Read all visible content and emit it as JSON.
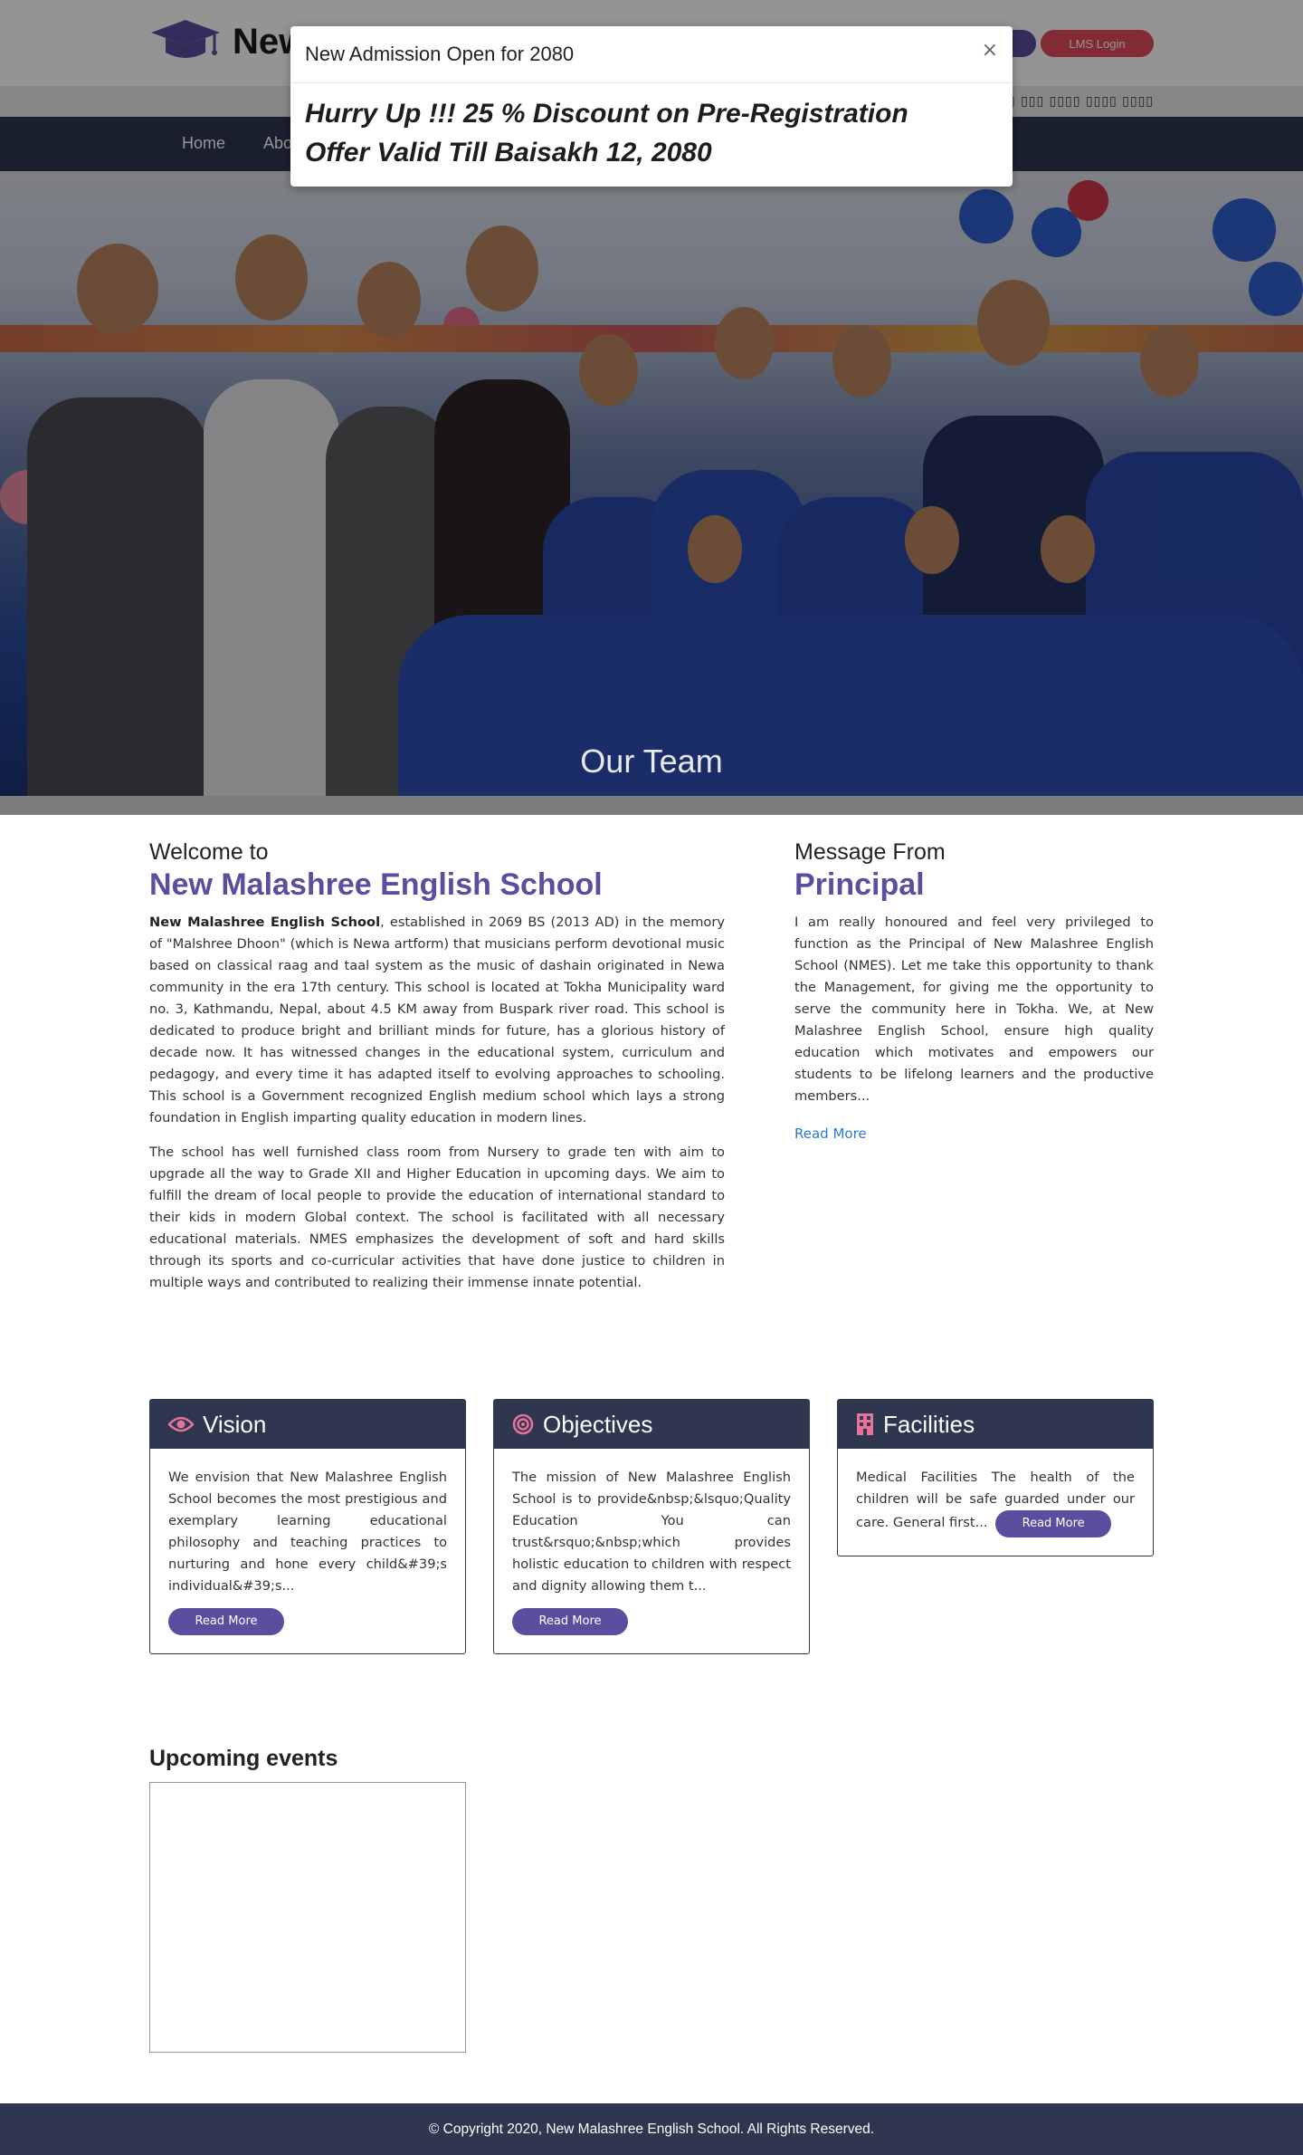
{
  "header": {
    "brand": "New",
    "lms_label": "LMS Login",
    "topbar_note": "▯▯ ▯▯▯ ▯▯▯▯ ▯▯▯▯ ▯▯▯▯"
  },
  "nav": {
    "items": [
      "Home",
      "Abo"
    ]
  },
  "hero": {
    "caption": "Our Team"
  },
  "modal": {
    "title": "New Admission Open for 2080",
    "close": "×",
    "line1": "Hurry Up !!! 25 % Discount on Pre-Registration",
    "line2": "Offer Valid Till Baisakh 12, 2080"
  },
  "welcome": {
    "kicker": "Welcome to",
    "title": "New Malashree English School",
    "para1_bold": "New Malashree English School",
    "para1_rest": ", established in 2069 BS (2013 AD) in the memory of \"Malshree Dhoon\" (which is Newa artform) that musicians perform devotional music based on classical raag and taal system as the music of dashain originated in  Newa community in the era 17th century.  This school is located at Tokha Municipality ward no. 3, Kathmandu, Nepal, about 4.5 KM away from Buspark river road. This school is dedicated to produce bright and brilliant minds for future, has a glorious history of decade now. It has witnessed changes in the educational system, curriculum and pedagogy, and every time it has adapted itself to evolving approaches to schooling. This school is a Government recognized English medium school which lays a strong foundation in English imparting quality education in modern lines.",
    "para2": "The school has well furnished class room from Nursery to grade ten with aim to upgrade all the way to Grade XII and Higher Education in upcoming days. We aim to fulfill the dream of local people to provide the education of international standard to their kids in modern Global context. The school is facilitated with all necessary educational materials. NMES emphasizes the development of soft and hard skills through its sports and co-curricular activities that have done justice to children in multiple ways and contributed to realizing their immense innate potential."
  },
  "principal": {
    "kicker": "Message From",
    "title": "Principal",
    "text": "I am really honoured and feel very privileged to function as the Principal of New Malashree English School (NMES). Let me take this opportunity to thank the Management, for giving me the opportunity to serve the community here in Tokha. We, at New Malashree English School, ensure high quality education which motivates and empowers our students to be lifelong learners and the productive members...",
    "read_more": "Read More"
  },
  "cards": {
    "vision": {
      "title": "Vision",
      "text": "We envision that New Malashree English School becomes the most prestigious and exemplary learning educational philosophy and teaching practices to nurturing and hone every child&#39;s individual&#39;s...",
      "button": "Read More"
    },
    "objectives": {
      "title": "Objectives",
      "text": "The mission of New Malashree English School is to provide&nbsp;&lsquo;Quality Education You can trust&rsquo;&nbsp;which provides holistic education to children with respect and dignity allowing them t...",
      "button": "Read More"
    },
    "facilities": {
      "title": "Facilities",
      "text": "Medical Facilities The health of the children will be safe guarded under our care. General first...",
      "button": "Read More"
    }
  },
  "events": {
    "title": "Upcoming events"
  },
  "footer": {
    "text": "© Copyright 2020, New Malashree English School. All Rights Reserved."
  },
  "colors": {
    "navy": "#2e3650",
    "purple": "#5a4f9e",
    "red": "#e24a5a",
    "pink_icon": "#e8739a",
    "link": "#2a7bd6"
  }
}
